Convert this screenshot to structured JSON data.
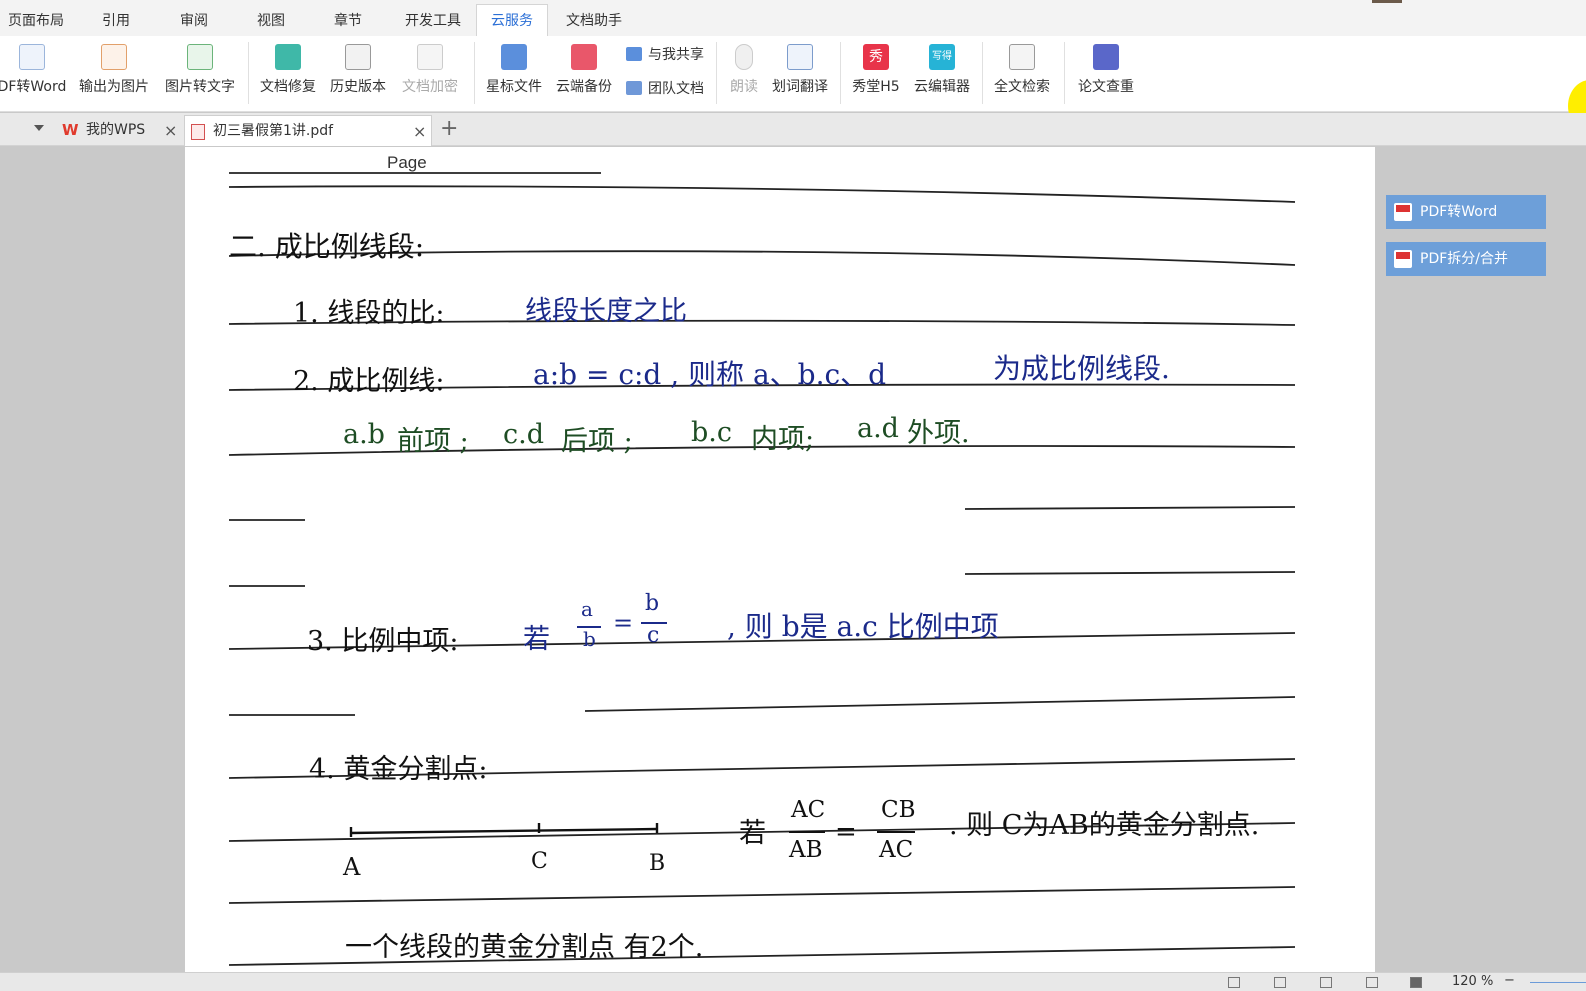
{
  "menu": {
    "tabs": [
      "页面布局",
      "引用",
      "审阅",
      "视图",
      "章节",
      "开发工具",
      "云服务",
      "文档助手"
    ],
    "active": "云服务"
  },
  "ribbon": {
    "pdf_to_word": "DF转Word",
    "export_image": "输出为图片",
    "image_to_text": "图片转文字",
    "doc_repair": "文档修复",
    "history": "历史版本",
    "doc_encrypt": "文档加密",
    "starred": "星标文件",
    "cloud_backup": "云端备份",
    "shared_with_me": "与我共享",
    "team_docs": "团队文档",
    "read_aloud": "朗读",
    "translate": "划词翻译",
    "show_h5": "秀堂H5",
    "show_icon_text": "秀",
    "cloud_editor": "云编辑器",
    "cloud_editor_icon_text": "写得",
    "fulltext_search": "全文检索",
    "paper_check": "论文查重"
  },
  "tabs": {
    "home": "我的WPS",
    "doc": "初三暑假第1讲.pdf",
    "close": "×",
    "add": "+"
  },
  "document": {
    "page_label": "Page",
    "l_heading": "二. 成比例线段:",
    "l1": "1. 线段的比:",
    "l1b": "线段长度之比",
    "l2": "2. 成比例线:",
    "l2b": "a:b = c:d , 则称 a、b.c、d",
    "l2c": "为成比例线段.",
    "l3a": "a.b",
    "l3b": "前项 ;",
    "l3c": "c.d",
    "l3d": "后项 ;",
    "l3e": "b.c",
    "l3f": "内项;",
    "l3g": "a.d",
    "l3h": "外项.",
    "l4": "3. 比例中项:",
    "l4_ruo": "若",
    "l4_a": "a",
    "l4_b1": "b",
    "l4_eq": "=",
    "l4_b2": "b",
    "l4_c": "c",
    "l4b": ", 则 b是 a.c 比例中项",
    "l5": "4. 黄金分割点:",
    "pt_a": "A",
    "pt_c": "C",
    "pt_b": "B",
    "l6_ruo": "若",
    "frac1_num": "AC",
    "frac1_den": "AB",
    "frac_eq": "=",
    "frac2_num": "CB",
    "frac2_den": "AC",
    "l6b": ". 则 C为AB的黄金分割点.",
    "l7": "一个线段的黄金分割点 有2个."
  },
  "side_panel": {
    "pdf_to_word": "PDF转Word",
    "split_merge": "PDF拆分/合并"
  },
  "status": {
    "zoom": "120 %",
    "zoom_minus": "−"
  }
}
